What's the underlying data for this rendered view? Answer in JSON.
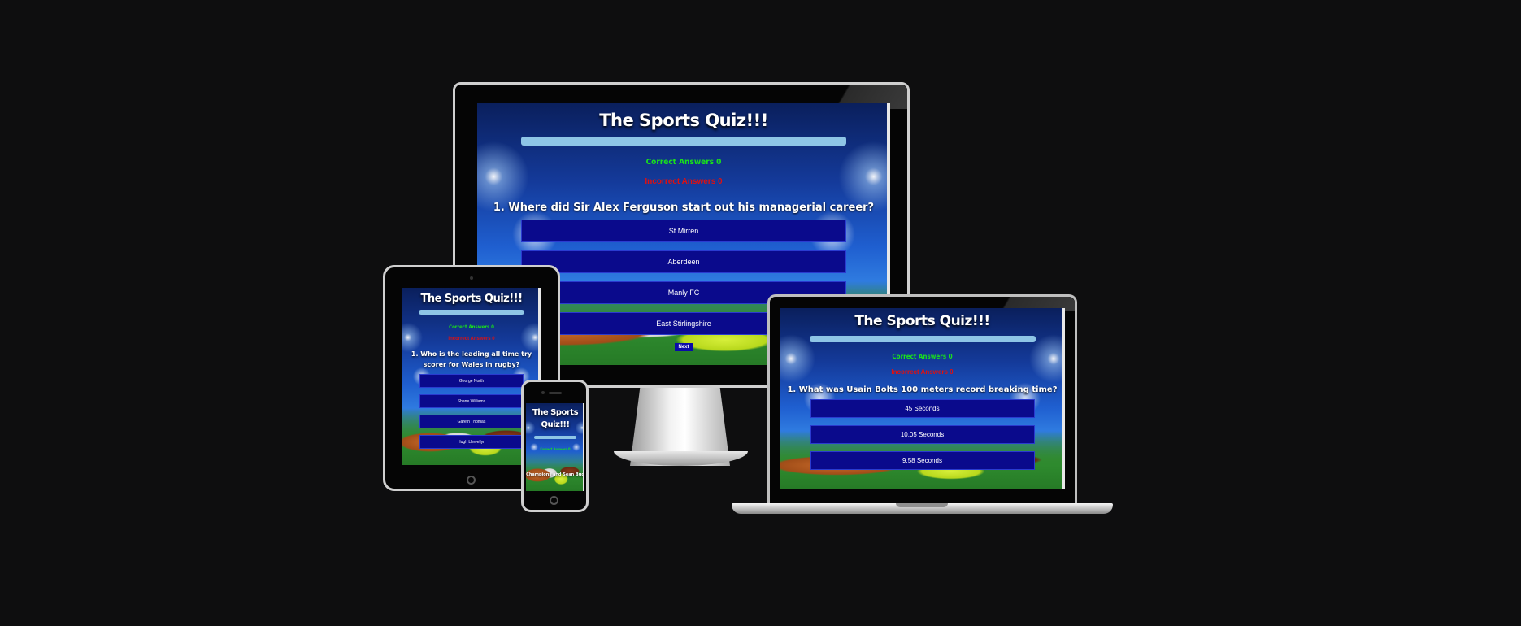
{
  "desktop": {
    "title": "The Sports Quiz!!!",
    "correct_label": "Correct Answers 0",
    "incorrect_label": "Incorrect Answers 0",
    "question": "1. Where did Sir Alex Ferguson start out his managerial career?",
    "answers": [
      "St Mirren",
      "Aberdeen",
      "Manly FC",
      "East Stirlingshire"
    ],
    "next_label": "Next"
  },
  "tablet": {
    "title": "The Sports Quiz!!!",
    "correct_label": "Correct Answers 0",
    "incorrect_label": "Incorrect Answers 0",
    "question": "1. Who is the leading all time try scorer for Wales in rugby?",
    "answers": [
      "George North",
      "Shane Williams",
      "Gareth Thomas",
      "Hugh Llewellyn"
    ]
  },
  "phone": {
    "title": "The Sports Quiz!!!",
    "correct_label": "Correct Answers 0",
    "footer_text": "Champions and Sean Bug"
  },
  "laptop": {
    "title": "The Sports Quiz!!!",
    "correct_label": "Correct Answers 0",
    "incorrect_label": "Incorrect Answers 0",
    "question": "1. What was Usain Bolts 100 meters record breaking time?",
    "answers": [
      "45 Seconds",
      "10.05 Seconds",
      "9.58 Seconds"
    ]
  },
  "colors": {
    "background": "#0e0e0f",
    "correct": "#19e21b",
    "incorrect": "#e01010",
    "answer_button": "#0a0a8c",
    "progress_bar": "#8ec5e6"
  }
}
